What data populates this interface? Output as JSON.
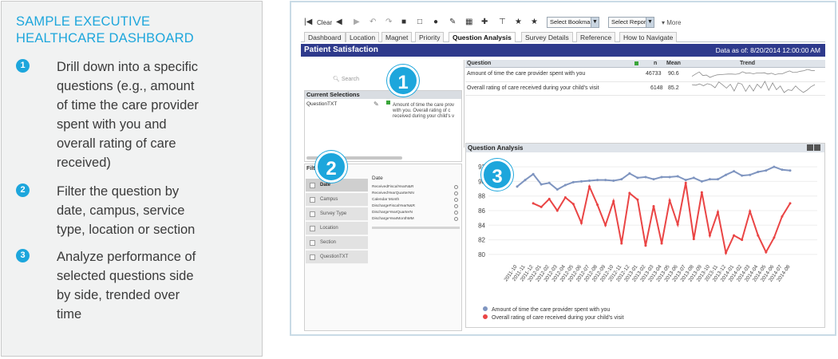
{
  "left_panel": {
    "title_line1": "SAMPLE EXECUTIVE",
    "title_line2": "HEALTHCARE DASHBOARD",
    "items": [
      {
        "num": "1",
        "lines": [
          "Drill down into a specific",
          "questions (e.g., amount",
          "of time the care provider",
          "spent with you and",
          "overall rating of care",
          "received)"
        ]
      },
      {
        "num": "2",
        "lines": [
          "Filter the question by",
          "date, campus, service",
          "type, location or section"
        ]
      },
      {
        "num": "3",
        "lines": [
          "Analyze performance of",
          "selected questions side",
          "by side, trended over",
          "time"
        ]
      }
    ]
  },
  "toolbar": {
    "clear_label": "Clear",
    "bookmark_select": "Select Bookmark",
    "report_select": "Select Report",
    "more_label": "More"
  },
  "tabs": [
    "Dashboard",
    "Location",
    "Magnet",
    "Priority",
    "Question Analysis",
    "Survey Details",
    "Reference",
    "How to Navigate"
  ],
  "active_tab": "Question Analysis",
  "header": {
    "title": "Patient Satisfaction",
    "data_as_of": "Data as of:  8/20/2014 12:00:00 AM"
  },
  "search_placeholder": "Search",
  "current_selections": {
    "title": "Current Selections",
    "field": "QuestionTXT",
    "value_lines": [
      "Amount of time the care prov",
      "with you. Overall rating of c",
      "received during your child's v"
    ]
  },
  "filters": {
    "title": "Filters",
    "items": [
      "Date",
      "Campus",
      "Survey Type",
      "Location",
      "Section",
      "QuestionTXT"
    ],
    "active": "Date",
    "date_label": "Date",
    "date_rows": [
      "ReceivedFiscalYearN&R",
      "ReceivedYearQuarterNN",
      "Calendar Month",
      "DischargeFiscalYearN&R",
      "DischargeYearQuarterN",
      "DischargeYearMonthMM"
    ]
  },
  "question_table": {
    "headers": [
      "Question",
      "n",
      "Mean",
      "Trend"
    ],
    "rows": [
      {
        "question": "Amount of time the care provider spent with you",
        "n": "46733",
        "mean": "90.6"
      },
      {
        "question": "Overall rating of care received during your child's visit",
        "n": "6148",
        "mean": "85.2"
      }
    ]
  },
  "chart_title": "Question Analysis",
  "badges": [
    "1",
    "2",
    "3"
  ],
  "chart_data": {
    "type": "line",
    "title": "Question Analysis",
    "xlabel": "",
    "ylabel": "",
    "ylim": [
      79,
      93
    ],
    "yticks": [
      80,
      82,
      84,
      86,
      88,
      90,
      92
    ],
    "x": [
      "2011-10",
      "2011-11",
      "2011-12",
      "2012-01",
      "2012-02",
      "2012-03",
      "2012-04",
      "2012-05",
      "2012-06",
      "2012-07",
      "2012-08",
      "2012-09",
      "2012-10",
      "2012-11",
      "2012-12",
      "2013-01",
      "2013-02",
      "2013-03",
      "2013-04",
      "2013-05",
      "2013-06",
      "2013-07",
      "2013-08",
      "2013-09",
      "2013-10",
      "2013-11",
      "2013-12",
      "2014-01",
      "2014-02",
      "2014-03",
      "2014-04",
      "2014-05",
      "2014-06",
      "2014-07",
      "2014-08"
    ],
    "series": [
      {
        "name": "Amount of time the care provider spent with you",
        "color": "#7f95c0",
        "values": [
          89.3,
          90.2,
          91.0,
          89.6,
          89.8,
          88.9,
          89.5,
          89.9,
          90.0,
          90.1,
          90.2,
          90.2,
          90.1,
          90.3,
          91.1,
          90.5,
          90.6,
          90.3,
          90.6,
          90.6,
          90.7,
          90.2,
          90.5,
          90.0,
          90.3,
          90.3,
          90.9,
          91.4,
          90.8,
          90.9,
          91.3,
          91.5,
          92.0,
          91.6,
          91.5
        ]
      },
      {
        "name": "Overall rating of care received during your child's visit",
        "color": "#ea4545",
        "values": [
          null,
          null,
          87.0,
          86.5,
          87.6,
          86.0,
          87.8,
          86.9,
          84.3,
          89.3,
          86.8,
          84.0,
          87.3,
          81.5,
          88.4,
          87.5,
          81.2,
          86.6,
          81.5,
          87.4,
          84.1,
          89.8,
          82.1,
          88.5,
          82.6,
          85.8,
          80.2,
          82.6,
          82.0,
          85.9,
          82.6,
          80.3,
          82.3,
          85.2,
          87.0
        ]
      }
    ],
    "legend_position": "bottom-left"
  }
}
